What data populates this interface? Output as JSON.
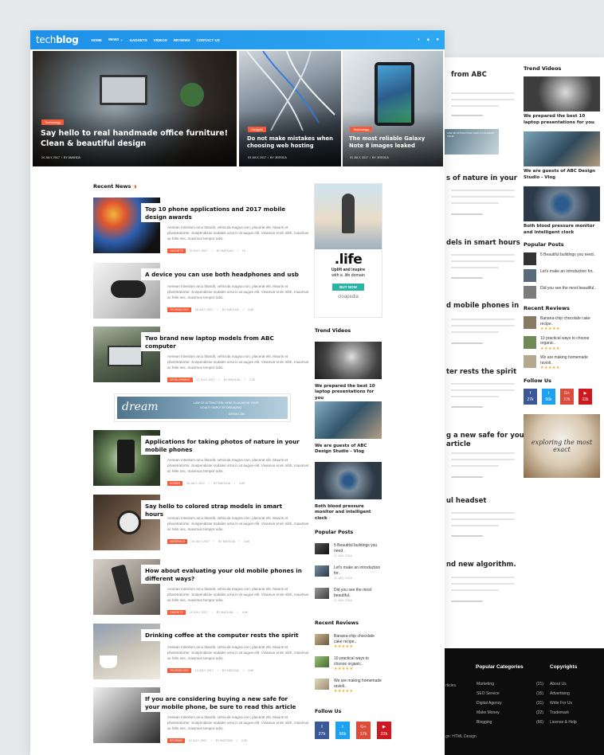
{
  "brand": {
    "name_light": "tech",
    "name_bold": "blog"
  },
  "nav": {
    "items": [
      "HOME",
      "NEWS",
      "GADGETS",
      "VIDEOS",
      "REVIEWS",
      "CONTACT US"
    ]
  },
  "hero": [
    {
      "category": "Technology",
      "title": "Say hello to real handmade office furniture! Clean & beautiful design",
      "date": "24 JULY, 2017",
      "author": "BY AMANDA"
    },
    {
      "category": "Gadgets",
      "title": "Do not make mistakes when choosing web hosting",
      "date": "03 JULY, 2017",
      "author": "BY JESSICA"
    },
    {
      "category": "Technology",
      "title": "The most reliable Galaxy Note 8 images leaked",
      "date": "01 JULY, 2017",
      "author": "BY JESSICA"
    }
  ],
  "recent": {
    "heading": "Recent News",
    "excerpt": "Aenean interdum arcu blandit, vehicula magna non, placerat elit. Mauris et pharetratortor. Suspendisse sodales urna in at augue elit. Vivamus enim nibh, maximus ac felis nec, maximus tempor odio.",
    "author": "BY MATILDA",
    "posts": [
      {
        "title": "Top 10 phone applications and 2017 mobile design awards",
        "tag": "GADGETS",
        "date": "20 JULY, 2017",
        "stat": "1K"
      },
      {
        "title": "A device you can use both headphones and usb",
        "tag": "TECHNOLOGY",
        "date": "18 JULY, 2017",
        "stat": "4.5K"
      },
      {
        "title": "Two brand new laptop models from ABC computer",
        "tag": "DEVELOPMENT",
        "date": "17 JULY, 2017",
        "stat": "2.2K"
      },
      {
        "title": "Applications for taking photos of nature in your mobile phones",
        "tag": "DESIGN",
        "date": "16 JULY, 2017",
        "stat": "4.6K"
      },
      {
        "title": "Say hello to colored strap models in smart hours",
        "tag": "MATERIALS",
        "date": "15 JULY, 2017",
        "stat": "3.5K"
      },
      {
        "title": "How about evaluating your old mobile phones in different ways?",
        "tag": "GADGETS",
        "date": "14 JULY, 2017",
        "stat": "4.4K"
      },
      {
        "title": "Drinking coffee at the computer rests the spirit",
        "tag": "TECHNOLOGY",
        "date": "13 JULY, 2017",
        "stat": "4.6K"
      },
      {
        "title": "If you are considering buying a new safe for your mobile phone, be sure to read this article",
        "tag": "REVIEWS",
        "date": "12 JULY, 2017",
        "stat": "2.2K"
      }
    ]
  },
  "banner": {
    "word": "dream",
    "line1": "LAW OF ATTRACTION: HOW TO ACHIEVE YOUR",
    "line2": "GOALS SIMPLY BY DREAMING",
    "line3": "DREAM.COM"
  },
  "ad": {
    "big": ".life",
    "line1": "Uplift and inspire",
    "line2": "with a .life domain",
    "button": "BUY NOW",
    "brand": "cloapedia"
  },
  "sidebar": {
    "trend_heading": "Trend Videos",
    "videos": [
      "We prepared the best 10 laptop presentations for you",
      "We are guests of ABC Design Studio - Vlog",
      "Both blood pressure monitor and intelligent clock"
    ],
    "popular_heading": "Popular Posts",
    "popular": [
      {
        "title": "5 Beautiful buildings you need..",
        "date": "11 JAN, 2016"
      },
      {
        "title": "Let's make an introduction for..",
        "date": "11 JAN, 2016"
      },
      {
        "title": "Did you see the most beautiful..",
        "date": "11 JAN, 2016"
      }
    ],
    "reviews_heading": "Recent Reviews",
    "reviews": [
      "Banana-chip chocolate cake recipe..",
      "10 practical ways to choose organic..",
      "We are making homemade ravioli.."
    ],
    "stars": "★★★★★",
    "follow_heading": "Follow Us",
    "social": [
      {
        "icon": "f",
        "count": "27k",
        "color": "#3b5998"
      },
      {
        "icon": "t",
        "count": "56k",
        "color": "#1da1f2"
      },
      {
        "icon": "G+",
        "count": "17k",
        "color": "#dd4b39"
      },
      {
        "icon": "▶",
        "count": "22k",
        "color": "#cc181e"
      }
    ]
  },
  "back_page": {
    "titles": [
      "from ABC",
      "s of nature in your",
      "dels in smart hours",
      "d mobile phones in",
      "ter rests the spirit",
      "g a new safe for your",
      "article",
      "ul headset",
      "nd new algorithm."
    ],
    "ad_text": "LAW OF ATTRACTION: HOW TO ACHIEVE YOUR",
    "trend_heading": "Trend Videos",
    "videos": [
      "We prepared the best 10 laptop presentations for you",
      "We are guests of ABC Design Studio - Vlog",
      "Both blood pressure monitor and intelligent clock"
    ],
    "popular_heading": "Popular Posts",
    "popular": [
      "5 Beautiful buildings you need..",
      "Let's make an introduction for..",
      "Did you see the most beautiful.."
    ],
    "reviews_heading": "Recent Reviews",
    "reviews": [
      "Banana-chip chocolate cake recipe..",
      "10 practical ways to choose organic..",
      "We are making homemade ravioli.."
    ],
    "follow_heading": "Follow Us",
    "social": [
      {
        "icon": "f",
        "count": "27k"
      },
      {
        "icon": "t",
        "count": "56k"
      },
      {
        "icon": "G+",
        "count": "17k"
      },
      {
        "icon": "▶",
        "count": "22k"
      }
    ],
    "ad_text2": "exploring the most exact"
  },
  "footer": {
    "categories_heading": "Popular Categories",
    "categories": [
      {
        "name": "Marketing",
        "count": "(21)"
      },
      {
        "name": "SEO Service",
        "count": "(15)"
      },
      {
        "name": "Digital Agency",
        "count": "(31)"
      },
      {
        "name": "Make Money",
        "count": "(22)"
      },
      {
        "name": "Blogging",
        "count": "(66)"
      }
    ],
    "copyrights_heading": "Copyrights",
    "links": [
      "About Us",
      "Advertising",
      "Write For Us",
      "Trademark",
      "License & Help"
    ],
    "left_frag1": "rticles.",
    "left_frag2": "gn: HTML Design"
  }
}
